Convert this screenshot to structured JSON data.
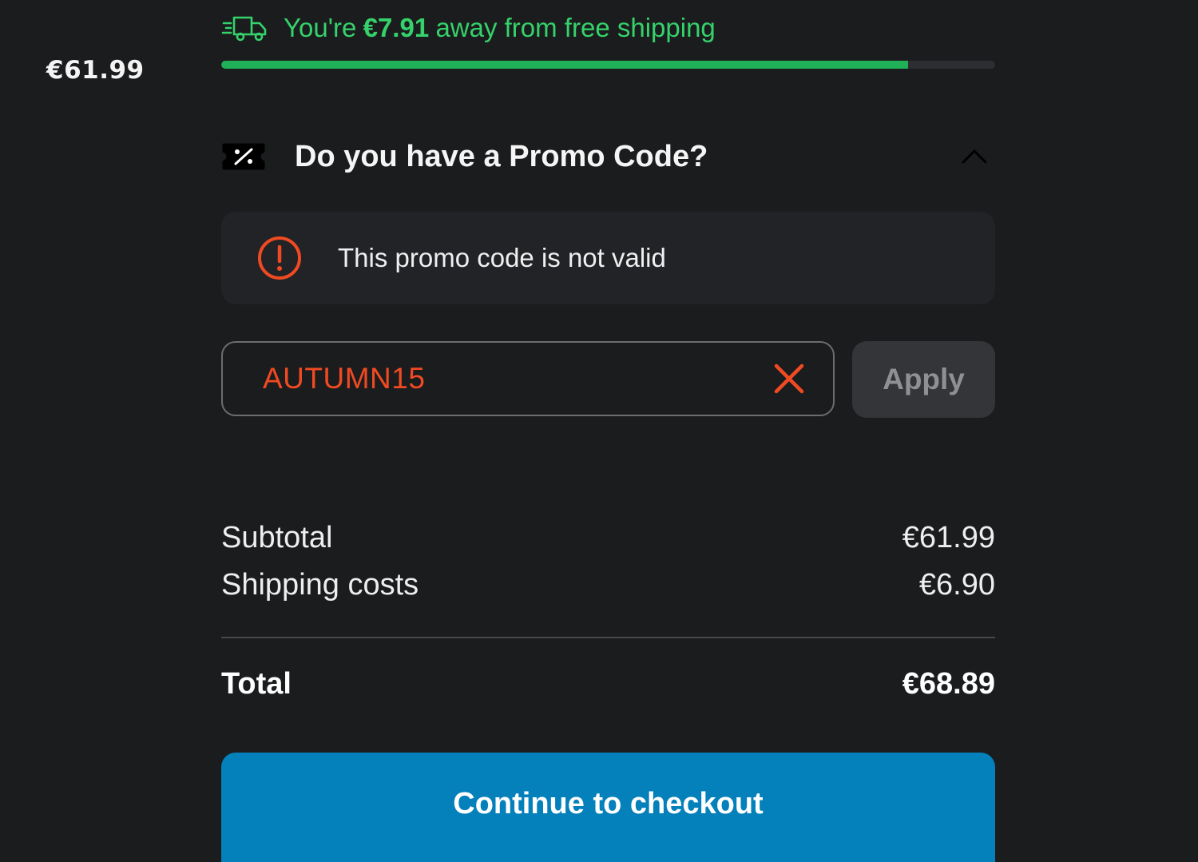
{
  "left_column": {
    "price": "€61.99"
  },
  "shipping_banner": {
    "text_before": "You're",
    "amount": "€7.91",
    "text_after": "away from free shipping",
    "progress_fraction": 0.888,
    "icon": "truck-icon",
    "color": "#35d26b"
  },
  "promo": {
    "header": "Do you have a Promo Code?",
    "icon": "percent-tag-icon",
    "toggle_icon": "chevron-up-icon",
    "expanded": true,
    "error_icon": "alert-circle-icon",
    "error_message": "This promo code is not valid",
    "error_color": "#f04a22",
    "input_value": "AUTUMN15",
    "clear_icon": "close-icon",
    "apply_label": "Apply"
  },
  "summary": {
    "subtotal_label": "Subtotal",
    "subtotal_value": "€61.99",
    "shipping_label": "Shipping costs",
    "shipping_value": "€6.90",
    "total_label": "Total",
    "total_value": "€68.89"
  },
  "checkout": {
    "label": "Continue to checkout",
    "color": "#0480ba"
  }
}
